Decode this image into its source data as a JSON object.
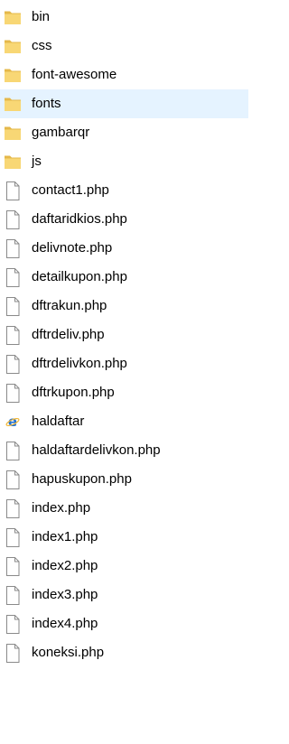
{
  "colors": {
    "folder_fill": "#f8d775",
    "folder_edge": "#e5b84a",
    "file_outline": "#8a8a8a",
    "selection_bg": "#e5f3ff",
    "ie_blue": "#1f6fd1"
  },
  "items": [
    {
      "name": "bin",
      "type": "folder",
      "icon": "folder-icon"
    },
    {
      "name": "css",
      "type": "folder",
      "icon": "folder-icon"
    },
    {
      "name": "font-awesome",
      "type": "folder",
      "icon": "folder-icon"
    },
    {
      "name": "fonts",
      "type": "folder",
      "icon": "folder-icon",
      "selected": true
    },
    {
      "name": "gambarqr",
      "type": "folder",
      "icon": "folder-icon"
    },
    {
      "name": "js",
      "type": "folder",
      "icon": "folder-icon"
    },
    {
      "name": "contact1.php",
      "type": "file",
      "icon": "file-icon"
    },
    {
      "name": "daftaridkios.php",
      "type": "file",
      "icon": "file-icon"
    },
    {
      "name": "delivnote.php",
      "type": "file",
      "icon": "file-icon"
    },
    {
      "name": "detailkupon.php",
      "type": "file",
      "icon": "file-icon"
    },
    {
      "name": "dftrakun.php",
      "type": "file",
      "icon": "file-icon"
    },
    {
      "name": "dftrdeliv.php",
      "type": "file",
      "icon": "file-icon"
    },
    {
      "name": "dftrdelivkon.php",
      "type": "file",
      "icon": "file-icon"
    },
    {
      "name": "dftrkupon.php",
      "type": "file",
      "icon": "file-icon"
    },
    {
      "name": "haldaftar",
      "type": "html",
      "icon": "internet-explorer-icon"
    },
    {
      "name": "haldaftardelivkon.php",
      "type": "file",
      "icon": "file-icon"
    },
    {
      "name": "hapuskupon.php",
      "type": "file",
      "icon": "file-icon"
    },
    {
      "name": "index.php",
      "type": "file",
      "icon": "file-icon"
    },
    {
      "name": "index1.php",
      "type": "file",
      "icon": "file-icon"
    },
    {
      "name": "index2.php",
      "type": "file",
      "icon": "file-icon"
    },
    {
      "name": "index3.php",
      "type": "file",
      "icon": "file-icon"
    },
    {
      "name": "index4.php",
      "type": "file",
      "icon": "file-icon"
    },
    {
      "name": "koneksi.php",
      "type": "file",
      "icon": "file-icon"
    }
  ]
}
